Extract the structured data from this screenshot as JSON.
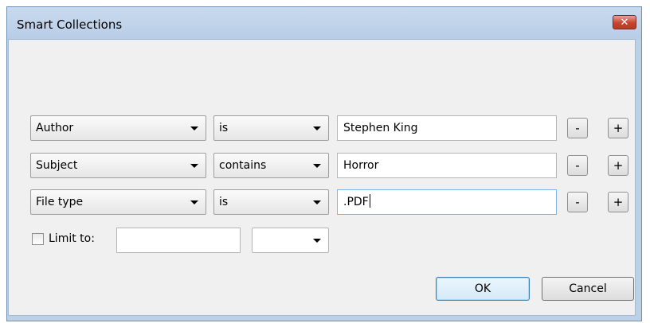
{
  "window": {
    "title": "Smart Collections",
    "close_glyph": "✕"
  },
  "rules": [
    {
      "field": "Author",
      "operator": "is",
      "value": "Stephen King",
      "remove_label": "-",
      "add_label": "+"
    },
    {
      "field": "Subject",
      "operator": "contains",
      "value": "Horror",
      "remove_label": "-",
      "add_label": "+"
    },
    {
      "field": "File type",
      "operator": "is",
      "value": ".PDF",
      "remove_label": "-",
      "add_label": "+"
    }
  ],
  "limit": {
    "label": "Limit to:",
    "checked": false,
    "value": "",
    "unit": ""
  },
  "buttons": {
    "ok": "OK",
    "cancel": "Cancel"
  },
  "icons": {
    "close": "close-icon",
    "dropdown": "chevron-down-icon"
  }
}
